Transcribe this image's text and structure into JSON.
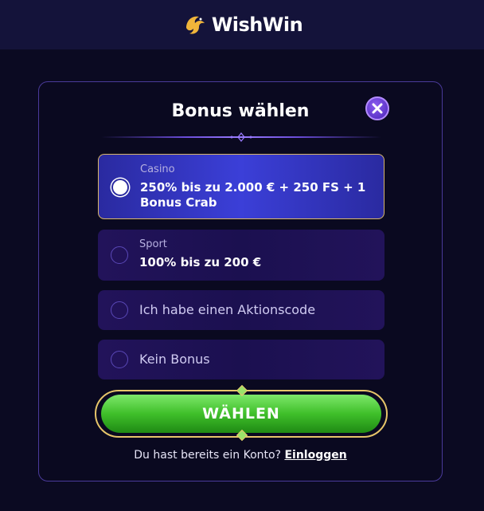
{
  "header": {
    "brand": "WishWin"
  },
  "modal": {
    "title": "Bonus wählen",
    "options": [
      {
        "category": "Casino",
        "text": "250% bis zu 2.000 € + 250 FS + 1 Bonus Crab",
        "selected": true
      },
      {
        "category": "Sport",
        "text": "100% bis zu 200 €",
        "selected": false
      },
      {
        "text": "Ich habe einen Aktionscode",
        "selected": false
      },
      {
        "text": "Kein Bonus",
        "selected": false
      }
    ],
    "submit_label": "WÄHLEN",
    "login_prompt": "Du hast bereits ein Konto?",
    "login_link": "Einloggen"
  },
  "colors": {
    "accent_gold": "#e6c56a",
    "button_green": "#3fbf2a",
    "selected_blue": "#3b3fd8"
  },
  "icons": {
    "close": "close-icon",
    "logo": "dragon-logo-icon"
  }
}
